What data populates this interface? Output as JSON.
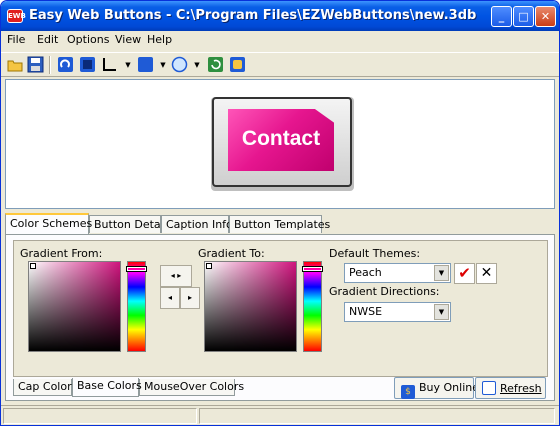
{
  "window": {
    "title": "Easy Web Buttons - C:\\Program Files\\EZWebButtons\\new.3db",
    "icon_text": "EWB",
    "controls": {
      "minimize": "_",
      "maximize": "□",
      "close": "✕"
    }
  },
  "menu": [
    "File",
    "Edit",
    "Options",
    "View",
    "Help"
  ],
  "toolbar": {
    "icons": [
      "open-folder-icon",
      "save-disk-icon",
      "rotate-icon",
      "square-shape-icon",
      "border-style-icon",
      "color-fill-icon",
      "ellipse-shape-icon",
      "refresh-icon",
      "export-icon"
    ]
  },
  "preview": {
    "button_label": "Contact",
    "button_color": "#e6168f"
  },
  "tabs": [
    "Color Schemes",
    "Button Details",
    "Caption Info",
    "Button Templates"
  ],
  "active_tab": "Color Schemes",
  "color_scheme": {
    "gradient_from_label": "Gradient From:",
    "gradient_to_label": "Gradient To:",
    "gradient_from_color": "#d0147e",
    "gradient_to_color": "#d0147e",
    "arrow_both": "◂ ▸",
    "arrow_left": "◂",
    "arrow_right": "▸",
    "default_themes_label": "Default Themes:",
    "default_theme_value": "Peach",
    "gradient_directions_label": "Gradient Directions:",
    "gradient_direction_value": "NWSE",
    "apply_symbol": "✔",
    "cancel_symbol": "✕"
  },
  "subtabs": [
    "Cap Colors",
    "Base Colors",
    "MouseOver Colors"
  ],
  "active_subtab": "Base Colors",
  "actions": {
    "buy_online": "Buy Online",
    "refresh": "Refresh"
  }
}
